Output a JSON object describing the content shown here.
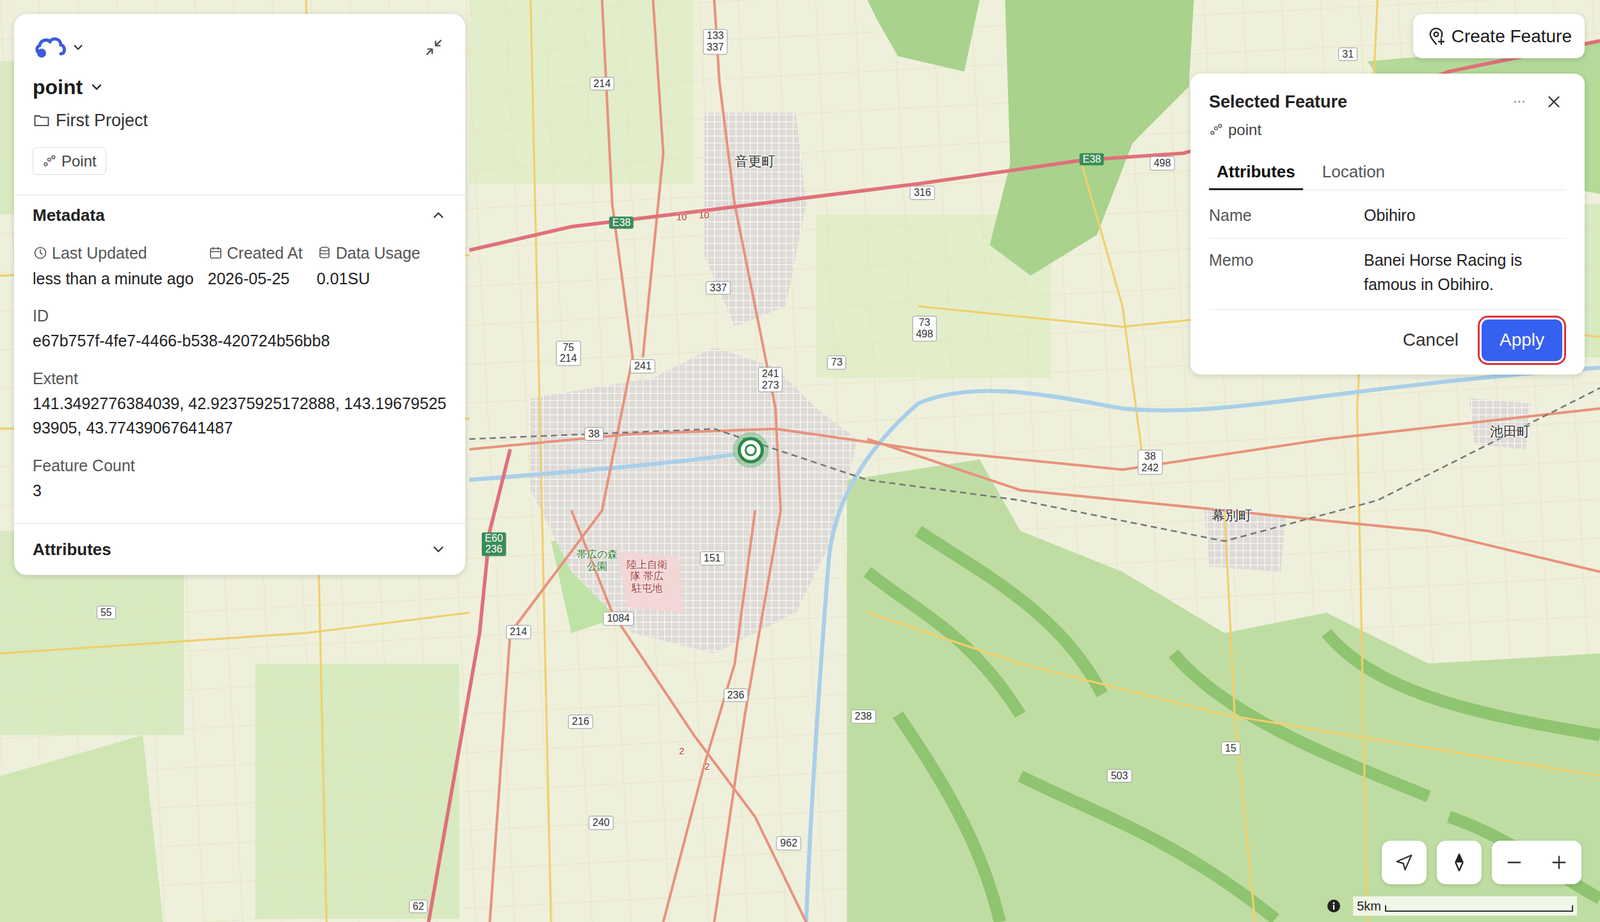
{
  "layer_panel": {
    "layer_name": "point",
    "project": "First Project",
    "type_badge": "Point",
    "metadata": {
      "title": "Metadata",
      "expanded": true,
      "fields": [
        {
          "label": "Last Updated",
          "value": "less than a minute ago"
        },
        {
          "label": "Created At",
          "value": "2026-05-25"
        },
        {
          "label": "Data Usage",
          "value": "0.01SU"
        }
      ],
      "details": [
        {
          "label": "ID",
          "value": "e67b757f-4fe7-4466-b538-420724b56bb8"
        },
        {
          "label": "Extent",
          "value": "141.3492776384039, 42.92375925172888, 143.1967952593905, 43.77439067641487"
        },
        {
          "label": "Feature Count",
          "value": "3"
        }
      ]
    },
    "attributes": {
      "title": "Attributes",
      "expanded": false
    }
  },
  "create_button": "Create Feature",
  "selected_feature": {
    "title": "Selected Feature",
    "layer": "point",
    "tabs": [
      {
        "label": "Attributes",
        "selected": true
      },
      {
        "label": "Location",
        "selected": false
      }
    ],
    "fields": [
      {
        "label": "Name",
        "value": "Obihiro"
      },
      {
        "label": "Memo",
        "value": "Banei Horse Racing is famous in Obihiro."
      }
    ],
    "cancel": "Cancel",
    "apply": {
      "label": "Apply",
      "highlighted": true
    }
  },
  "map": {
    "pin": {
      "selected": true
    },
    "scale": "5km",
    "labels": [
      {
        "lines": [
          "133",
          "337"
        ],
        "kind": "shield"
      },
      {
        "lines": [
          "214"
        ],
        "kind": "shield"
      },
      {
        "lines": [
          "音更町"
        ],
        "kind": "town"
      },
      {
        "lines": [
          "E38"
        ],
        "kind": "expy"
      },
      {
        "lines": [
          "10"
        ],
        "kind": "road"
      },
      {
        "lines": [
          "10"
        ],
        "kind": "road"
      },
      {
        "lines": [
          "316"
        ],
        "kind": "shield"
      },
      {
        "lines": [
          "E38"
        ],
        "kind": "expy"
      },
      {
        "lines": [
          "498"
        ],
        "kind": "shield"
      },
      {
        "lines": [
          "31"
        ],
        "kind": "shield"
      },
      {
        "lines": [
          "337"
        ],
        "kind": "shield"
      },
      {
        "lines": [
          "75",
          "214"
        ],
        "kind": "shield"
      },
      {
        "lines": [
          "241"
        ],
        "kind": "shield"
      },
      {
        "lines": [
          "73",
          "498"
        ],
        "kind": "shield"
      },
      {
        "lines": [
          "73"
        ],
        "kind": "shield"
      },
      {
        "lines": [
          "241",
          "273"
        ],
        "kind": "shield"
      },
      {
        "lines": [
          "38"
        ],
        "kind": "shield"
      },
      {
        "lines": [
          "38",
          "242"
        ],
        "kind": "shield"
      },
      {
        "lines": [
          "池田町"
        ],
        "kind": "town"
      },
      {
        "lines": [
          "幕別町"
        ],
        "kind": "town"
      },
      {
        "lines": [
          "E60",
          "236"
        ],
        "kind": "expy"
      },
      {
        "lines": [
          "帯広の森",
          "公園"
        ],
        "kind": "park"
      },
      {
        "lines": [
          "陸上自衛",
          "隊 帯広",
          "駐屯地"
        ],
        "kind": "base"
      },
      {
        "lines": [
          "151"
        ],
        "kind": "shield"
      },
      {
        "lines": [
          "1084"
        ],
        "kind": "shield"
      },
      {
        "lines": [
          "214"
        ],
        "kind": "shield"
      },
      {
        "lines": [
          "236"
        ],
        "kind": "shield"
      },
      {
        "lines": [
          "216"
        ],
        "kind": "shield"
      },
      {
        "lines": [
          "238"
        ],
        "kind": "shield"
      },
      {
        "lines": [
          "15"
        ],
        "kind": "shield"
      },
      {
        "lines": [
          "503"
        ],
        "kind": "shield"
      },
      {
        "lines": [
          "55"
        ],
        "kind": "shield"
      },
      {
        "lines": [
          "240"
        ],
        "kind": "shield"
      },
      {
        "lines": [
          "962"
        ],
        "kind": "shield"
      },
      {
        "lines": [
          "62"
        ],
        "kind": "shield"
      },
      {
        "lines": [
          "2"
        ],
        "kind": "road"
      },
      {
        "lines": [
          "2"
        ],
        "kind": "road"
      }
    ]
  }
}
